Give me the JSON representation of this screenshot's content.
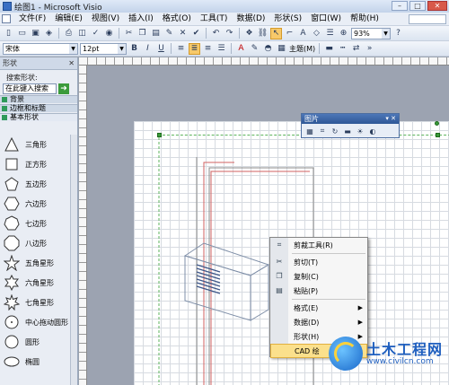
{
  "window": {
    "title": "绘图1 - Microsoft Visio"
  },
  "menu": [
    "文件(F)",
    "编辑(E)",
    "视图(V)",
    "插入(I)",
    "格式(O)",
    "工具(T)",
    "数据(D)",
    "形状(S)",
    "窗口(W)",
    "帮助(H)"
  ],
  "toolbar": {
    "zoom": "93%",
    "font_name": "宋体",
    "font_size": "12pt",
    "theme_label": "主题(M)",
    "text_color": "#c00000",
    "highlight_color": "#f7c96a"
  },
  "shapes_panel": {
    "title": "形状",
    "search_label": "搜索形状:",
    "search_placeholder": "在此键入搜索",
    "stencils": [
      "背景",
      "边框和标题",
      "基本形状"
    ],
    "shapes": [
      "三角形",
      "正方形",
      "五边形",
      "六边形",
      "七边形",
      "八边形",
      "五角星形",
      "六角星形",
      "七角星形",
      "中心拖动圆形",
      "圆形",
      "椭圆"
    ]
  },
  "image_toolbar": {
    "title": "图片"
  },
  "context_menu": {
    "items": [
      {
        "label": "剪裁工具(R)",
        "icon": "crop-icon"
      },
      {
        "label": "剪切(T)",
        "icon": "scissors-icon"
      },
      {
        "label": "复制(C)",
        "icon": "copy-icon"
      },
      {
        "label": "粘贴(P)",
        "icon": "paste-icon"
      },
      {
        "label": "格式(E)",
        "icon": ""
      },
      {
        "label": "数据(D)",
        "icon": ""
      },
      {
        "label": "形状(H)",
        "icon": ""
      },
      {
        "label": "CAD 绘",
        "icon": ""
      }
    ]
  },
  "watermark": {
    "title": "土木工程网",
    "url": "www.civilcn.com"
  }
}
